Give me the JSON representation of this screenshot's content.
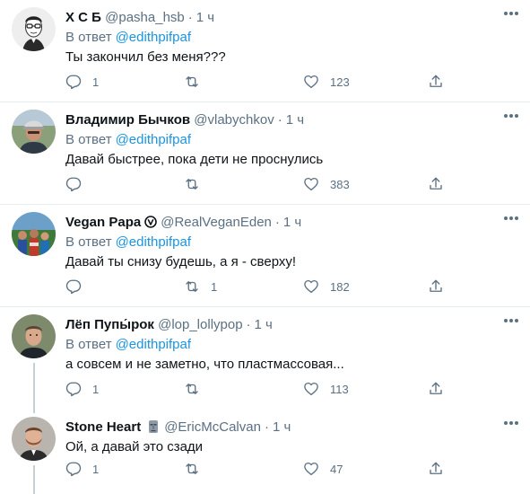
{
  "reply_prefix": "В ответ",
  "tweets": [
    {
      "name": "Х С Б",
      "handle": "@pasha_hsb",
      "time": "1 ч",
      "reply_to": "@edithpifpaf",
      "text": "Ты закончил без меня???",
      "replies": "1",
      "retweets": "",
      "likes": "123",
      "avatar_icon": "sketch-portrait"
    },
    {
      "name": "Владимир Бычков",
      "handle": "@vlabychkov",
      "time": "1 ч",
      "reply_to": "@edithpifpaf",
      "text": "Давай быстрее, пока дети не проснулись",
      "replies": "",
      "retweets": "",
      "likes": "383",
      "avatar_icon": "photo-man-cap"
    },
    {
      "name": "Vegan Papa",
      "handle": "@RealVeganEden",
      "time": "1 ч",
      "reply_to": "@edithpifpaf",
      "text": "Давай ты снизу будешь, а я - сверху!",
      "replies": "",
      "retweets": "1",
      "likes": "182",
      "avatar_icon": "photo-group-outdoors"
    },
    {
      "name": "Лёп Пупы́рок",
      "handle": "@lop_lollypop",
      "time": "1 ч",
      "reply_to": "@edithpifpaf",
      "text": "а совсем и не заметно, что пластмассовая...",
      "replies": "1",
      "retweets": "",
      "likes": "113",
      "avatar_icon": "photo-man-portrait"
    },
    {
      "name": "Stone Heart",
      "handle": "@EricMcCalvan",
      "time": "1 ч",
      "reply_to": "",
      "text": "Ой, а давай это сзади",
      "replies": "1",
      "retweets": "",
      "likes": "47",
      "avatar_icon": "photo-man-beard"
    }
  ],
  "colors": {
    "secondary_text": "#5b7083",
    "link": "#1b95e0",
    "divider": "#e6ecf0",
    "thread_line": "#c4cfd6"
  }
}
